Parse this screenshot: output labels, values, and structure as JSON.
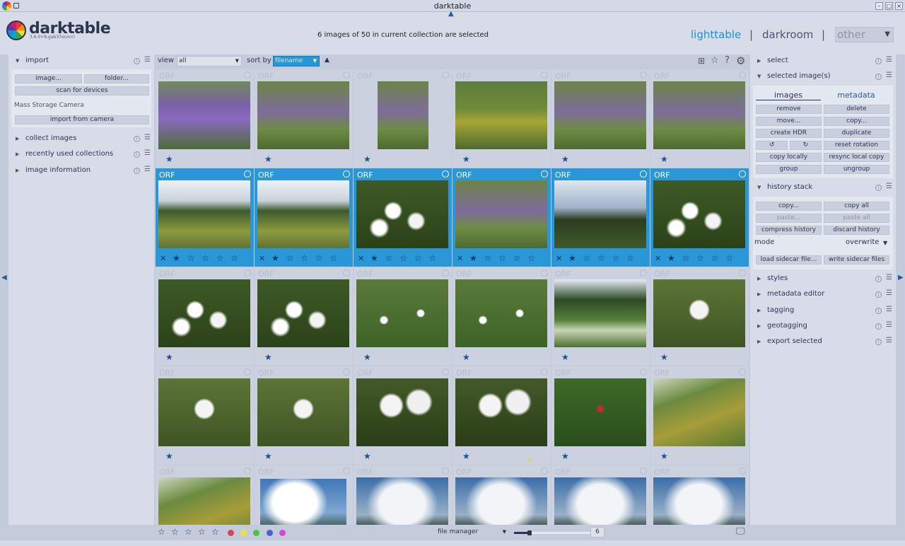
{
  "window": {
    "title": "darktable"
  },
  "app": {
    "name": "darktable",
    "version": "3.6.0+8.gab37ecoccl"
  },
  "header": {
    "status": "6 images of 50 in current collection are selected",
    "views": {
      "lighttable": "lighttable",
      "darkroom": "darkroom",
      "other": "other",
      "sep": "|"
    }
  },
  "left": {
    "import": {
      "label": "import",
      "image_btn": "image...",
      "folder_btn": "folder...",
      "scan_btn": "scan for devices",
      "camera_label": "Mass Storage Camera",
      "import_camera_btn": "import from camera"
    },
    "collect_images": "collect images",
    "recent_collections": "recently used collections",
    "image_information": "image information"
  },
  "toolbar": {
    "view_label": "view",
    "view_value": "all",
    "sort_label": "sort by",
    "sort_value": "filename",
    "sort_dir": "▲"
  },
  "right": {
    "select": "select",
    "selected_images": {
      "label": "selected image(s)",
      "tab_images": "images",
      "tab_metadata": "metadata",
      "remove": "remove",
      "delete": "delete",
      "move": "move...",
      "copy": "copy...",
      "create_hdr": "create HDR",
      "duplicate": "duplicate",
      "rotate_ccw": "↺",
      "rotate_cw": "↻",
      "reset_rotation": "reset rotation",
      "copy_locally": "copy locally",
      "resync_local_copy": "resync local copy",
      "group": "group",
      "ungroup": "ungroup"
    },
    "history_stack": {
      "label": "history stack",
      "copy": "copy...",
      "copy_all": "copy all",
      "paste": "paste...",
      "paste_all": "paste all",
      "compress_history": "compress history",
      "discard_history": "discard history",
      "mode_label": "mode",
      "mode_value": "overwrite",
      "load_sidecar": "load sidecar file...",
      "write_sidecar": "write sidecar files"
    },
    "styles": "styles",
    "metadata_editor": "metadata editor",
    "tagging": "tagging",
    "geotagging": "geotagging",
    "export_selected": "export selected"
  },
  "thumbnails": {
    "format": "ORF",
    "stars_rated_one": "★",
    "stars_selected": "★ ☆ ☆ ☆ ☆",
    "reject": "✕"
  },
  "bottom": {
    "stars": [
      "☆",
      "☆",
      "☆",
      "☆",
      "☆"
    ],
    "color_labels": [
      "#e0454a",
      "#e8e046",
      "#49c447",
      "#4f5ed6",
      "#d448d4",
      "#c6ccd8"
    ],
    "layout": "file manager",
    "zoom_value": "6",
    "zoom_fraction": 0.2
  },
  "colors": {
    "accent": "#1d8fd6",
    "selected_cell": "#2a97d8"
  }
}
